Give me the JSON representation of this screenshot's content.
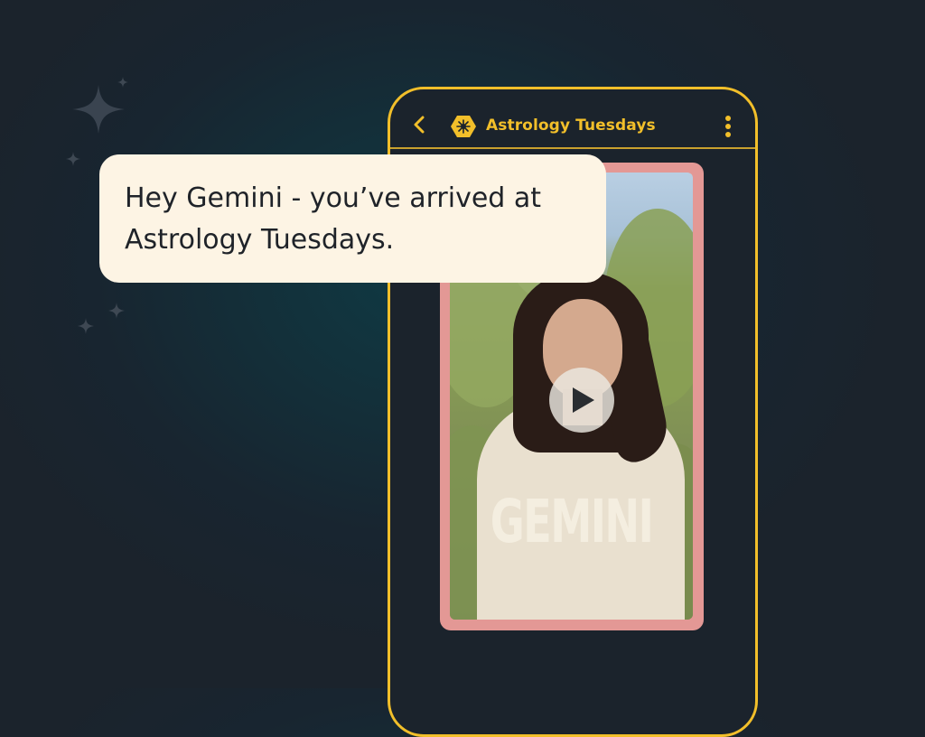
{
  "chat_header": {
    "title": "Astrology Tuesdays",
    "back_icon": "chevron-left-icon",
    "channel_icon": "sun-badge-icon",
    "menu_icon": "more-vertical-icon"
  },
  "message": {
    "text": "Hey Gemini - you’ve arrived at Astrology Tuesdays."
  },
  "video": {
    "overlay_text": "GEMINI",
    "play_icon": "play-icon"
  },
  "colors": {
    "accent": "#f2bf2a",
    "card_border": "#e39895",
    "bubble": "#fdf4e4",
    "background": "#1b232c"
  }
}
